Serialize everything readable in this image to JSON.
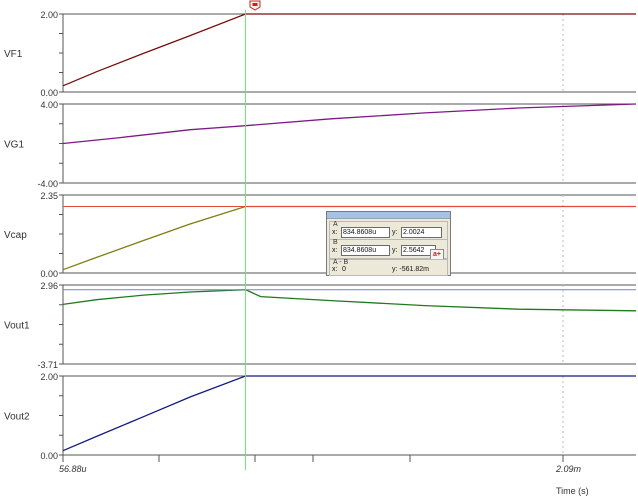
{
  "colors": {
    "VF1": "#7a0d0d",
    "VG1": "#7c1a86",
    "Vcap": "#7f7d10",
    "Vout1": "#1e7a1e",
    "Vout2": "#111b80",
    "cursor_A": "#74e074",
    "cursor_B_vcap": "#e54b3c",
    "cursor_B_vout1": "#7a7ad8"
  },
  "chart_data": {
    "type": "line",
    "x_unit": "Time (s)",
    "xlim": [
      5.688e-05,
      0.0025
    ],
    "x_tick_labels": [
      "56.88u",
      "2.09m"
    ],
    "xlabel": "Time (s)",
    "cursor_A_x": 0.0008348608,
    "plots": [
      {
        "name": "VF1",
        "ylim": [
          0.0,
          2.0
        ],
        "y_tick_labels": [
          "2.00",
          "0.00"
        ],
        "x": [
          5.688e-05,
          0.0002,
          0.0004,
          0.0006,
          0.0008348608,
          0.0012,
          0.0016,
          0.002,
          0.0025
        ],
        "values": [
          0.16,
          0.52,
          0.99,
          1.45,
          2.0,
          2.0,
          2.0,
          2.0,
          2.0
        ]
      },
      {
        "name": "VG1",
        "ylim": [
          -4.0,
          4.0
        ],
        "y_tick_labels": [
          "4.00",
          "-4.00"
        ],
        "x": [
          5.688e-05,
          0.0003,
          0.0006,
          0.0008348608,
          0.0012,
          0.0016,
          0.002,
          0.0025
        ],
        "values": [
          0.0,
          0.6,
          1.4,
          1.8,
          2.5,
          3.1,
          3.6,
          4.0
        ]
      },
      {
        "name": "Vcap",
        "ylim": [
          0.0,
          2.35
        ],
        "y_tick_labels": [
          "2.35",
          "0.00"
        ],
        "x": [
          5.688e-05,
          0.0002,
          0.0004,
          0.0006,
          0.0008348608,
          0.0012,
          0.0016,
          0.002,
          0.0025
        ],
        "values": [
          0.1,
          0.47,
          0.98,
          1.48,
          2.0024,
          2.0024,
          2.0024,
          2.0024,
          2.0024
        ]
      },
      {
        "name": "Vout1",
        "ylim": [
          -3.71,
          2.96
        ],
        "y_tick_labels": [
          "2.96",
          "-3.71"
        ],
        "x": [
          5.688e-05,
          0.0002,
          0.0004,
          0.0006,
          0.0008348608,
          0.0009,
          0.0012,
          0.0016,
          0.002,
          0.0025
        ],
        "values": [
          1.32,
          1.72,
          2.11,
          2.37,
          2.5642,
          1.98,
          1.64,
          1.22,
          0.92,
          0.78
        ]
      },
      {
        "name": "Vout2",
        "ylim": [
          0.0,
          2.0
        ],
        "y_tick_labels": [
          "2.00",
          "0.00"
        ],
        "x": [
          5.688e-05,
          0.0002,
          0.0004,
          0.0006,
          0.0008348608,
          0.0012,
          0.0016,
          0.002,
          0.0025
        ],
        "values": [
          0.11,
          0.47,
          0.97,
          1.47,
          2.0,
          2.0,
          2.0,
          2.0,
          2.0
        ]
      }
    ],
    "grid": true
  },
  "cursor_readout": {
    "a_label": "A",
    "b_label": "B",
    "ab_label": "A - B",
    "x_label": "x:",
    "y_label": "y:",
    "a_x": "834.8608u",
    "a_y": "2.0024",
    "b_x": "834.8608u",
    "b_y": "2.5642",
    "ab_x": "0",
    "ab_y": "y: -561.82m",
    "ab_button": "a+"
  }
}
